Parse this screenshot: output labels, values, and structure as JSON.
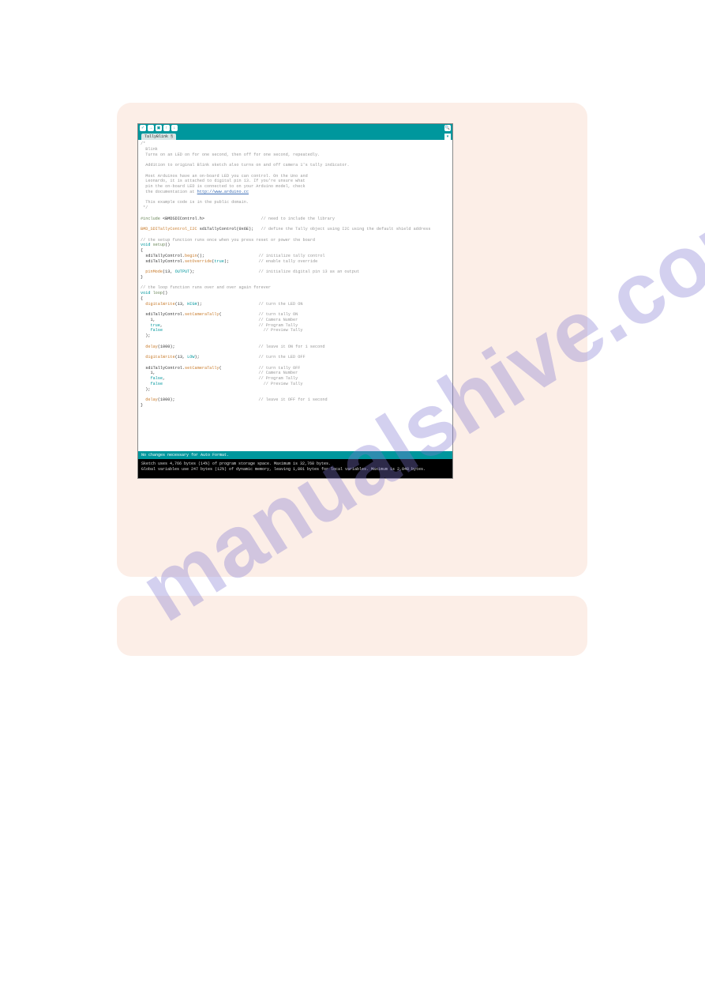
{
  "watermark": "manualshive.com",
  "ide": {
    "tab_name": "TallyBlink §",
    "status_bar": "No changes necessary for Auto Format.",
    "console_line1": "Sketch uses 4,766 bytes (14%) of program storage space. Maximum is 32,768 bytes.",
    "console_line2": "Global variables use 247 bytes (12%) of dynamic memory, leaving 1,801 bytes for local variables. Maximum is 2,048 bytes.",
    "code": {
      "c01": "/*",
      "c02": "  Blink",
      "c03": "  Turns on an LED on for one second, then off for one second, repeatedly.",
      "c04": "  Addition to original Blink sketch also turns on and off camera 1's tally indicator.",
      "c05": "  Most Arduinos have an on-board LED you can control. On the Uno and",
      "c06": "  Leonardo, it is attached to digital pin 13. If you're unsure what",
      "c07": "  pin the on-board LED is connected to on your Arduino model, check",
      "c08": "  the documentation at ",
      "c08_link": "http://www.arduino.cc",
      "c09": "  This example code is in the public domain.",
      "c10": " */",
      "c11a": "#include",
      "c11b": " <BMDSDIControl.h>",
      "c11c": "                       // need to include the library",
      "c12a": "BMD_SDITallyControl_I2C",
      "c12b": " sdiTallyControl(0x6E);",
      "c12c": "   // define the Tally object using I2C using the default shield address",
      "c13": "// the setup function runs once when you press reset or power the board",
      "c14a": "void",
      "c14b": " setup",
      "c14c": "()",
      "c15": "{",
      "c16a": "  sdiTallyControl.",
      "c16b": "begin",
      "c16c": "();",
      "c16d": "                      // initialize tally control",
      "c17a": "  sdiTallyControl.",
      "c17b": "setOverride",
      "c17c": "(",
      "c17d": "true",
      "c17e": ");",
      "c17f": "            // enable tally override",
      "c18a": "  pinMode",
      "c18b": "(13, ",
      "c18c": "OUTPUT",
      "c18d": ");",
      "c18e": "                          // initialize digital pin 13 as an output",
      "c19": "}",
      "c20": "// the loop function runs over and over again forever",
      "c21a": "void",
      "c21b": " loop",
      "c21c": "()",
      "c22": "{",
      "c23a": "  digitalWrite",
      "c23b": "(13, ",
      "c23c": "HIGH",
      "c23d": ");",
      "c23e": "                       // turn the LED ON",
      "c24a": "  sdiTallyControl.",
      "c24b": "setCameraTally",
      "c24c": "(",
      "c24d": "               // turn tally ON",
      "c25a": "    1,",
      "c25b": "                                          // Camera Number",
      "c26a": "    true",
      "c26b": ",",
      "c26c": "                                       // Program Tally",
      "c27a": "    false",
      "c27b": "                                         // Preview Tally",
      "c28": "  );",
      "c29a": "  delay",
      "c29b": "(1000);",
      "c29c": "                                  // leave it ON for 1 second",
      "c30a": "  digitalWrite",
      "c30b": "(13, ",
      "c30c": "LOW",
      "c30d": ");",
      "c30e": "                        // turn the LED OFF",
      "c31a": "  sdiTallyControl.",
      "c31b": "setCameraTally",
      "c31c": "(",
      "c31d": "               // turn tally OFF",
      "c32a": "    1,",
      "c32b": "                                          // Camera Number",
      "c33a": "    false",
      "c33b": ",",
      "c33c": "                                      // Program Tally",
      "c34a": "    false",
      "c34b": "                                         // Preview Tally",
      "c35": "  );",
      "c36a": "  delay",
      "c36b": "(1000);",
      "c36c": "                                  // leave it OFF for 1 second",
      "c37": "}"
    }
  }
}
